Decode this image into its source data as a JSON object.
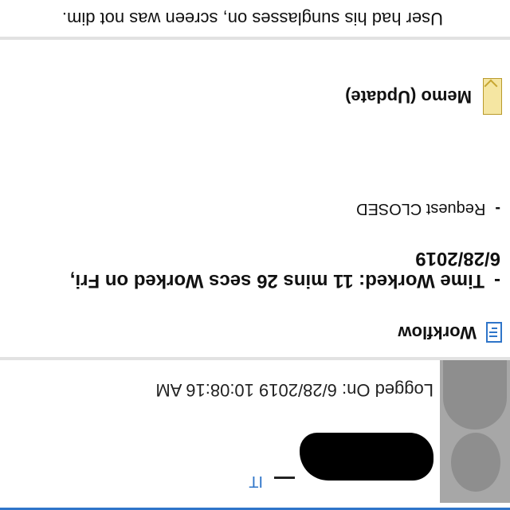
{
  "entry": {
    "role_link": "IT",
    "logged_on": "Logged On: 6/28/2019 10:08:16 AM"
  },
  "workflow": {
    "title": "Workflow",
    "icon": "workflow-icon",
    "time_worked": "Time Worked: 11 mins 26 secs Worked on Fri, 6/28/2019",
    "request_status": "Request CLOSED",
    "bullet": "-"
  },
  "memo": {
    "title": "Memo (Update)",
    "icon": "memo-icon",
    "note": "User had his sunglasses on, screen was not dim."
  }
}
